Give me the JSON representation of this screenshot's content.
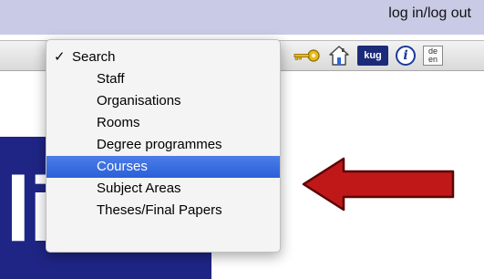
{
  "header": {
    "login_label": "log in/log out"
  },
  "toolbar": {
    "icons": [
      {
        "name": "key-icon"
      },
      {
        "name": "home-icon"
      },
      {
        "name": "kug-logo-icon",
        "text": "kug"
      },
      {
        "name": "info-icon",
        "text": "i"
      },
      {
        "name": "language-icon",
        "text_top": "de",
        "text_bottom": "en"
      }
    ]
  },
  "dropdown": {
    "selected_check": "✓",
    "items": [
      {
        "label": "Search",
        "selected": true
      },
      {
        "label": "Staff"
      },
      {
        "label": "Organisations"
      },
      {
        "label": "Rooms"
      },
      {
        "label": "Degree programmes"
      },
      {
        "label": "Courses",
        "highlighted": true
      },
      {
        "label": "Subject Areas"
      },
      {
        "label": "Theses/Final Papers"
      }
    ]
  },
  "background_logo": {
    "text": "li"
  },
  "colors": {
    "highlight": "#2a5fd8",
    "arrow": "#c01818",
    "logo_block": "#1f2585"
  }
}
